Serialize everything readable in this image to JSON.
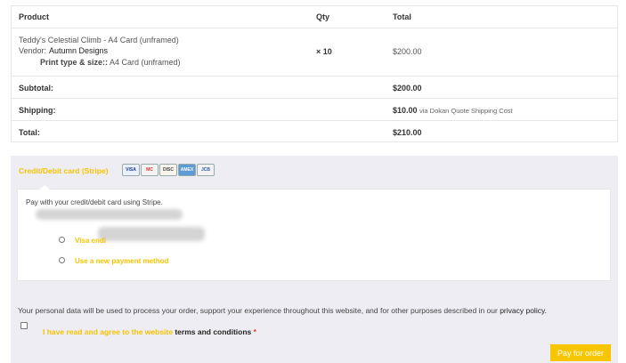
{
  "table": {
    "headers": {
      "product": "Product",
      "qty": "Qty",
      "total": "Total"
    },
    "item": {
      "name": "Teddy's Celestial Climb - A4 Card (unframed)",
      "vendor_label": "Vendor:",
      "vendor": "Autumn Designs",
      "option_label": "Print type & size::",
      "option_value": "A4 Card (unframed)",
      "qty": "× 10",
      "total": "$200.00"
    },
    "subtotal": {
      "label": "Subtotal:",
      "value": "$200.00"
    },
    "shipping": {
      "label": "Shipping:",
      "value": "$10.00",
      "method": "via Dokan Quote Shipping Cost"
    },
    "total": {
      "label": "Total:",
      "value": "$210.00"
    }
  },
  "payment": {
    "method_title": "Credit/Debit card (Stripe)",
    "card_icons": [
      "VISA",
      "MC",
      "DISC",
      "AMEX",
      "JCB"
    ],
    "description": "Pay with your credit/debit card using Stripe.",
    "saved_card_label": "Visa endi",
    "new_method_label": "Use a new payment method"
  },
  "privacy": {
    "text": "Your personal data will be used to process your order, support your experience throughout this website, and for other purposes described in our ",
    "link": "privacy policy."
  },
  "terms": {
    "prefix": "I have read and agree to the website ",
    "link": "terms and conditions",
    "required": "*"
  },
  "pay_button": "Pay for order",
  "colors": {
    "accent": "#f7c600",
    "panel_bg": "#eeedf3",
    "required": "#e33333"
  }
}
